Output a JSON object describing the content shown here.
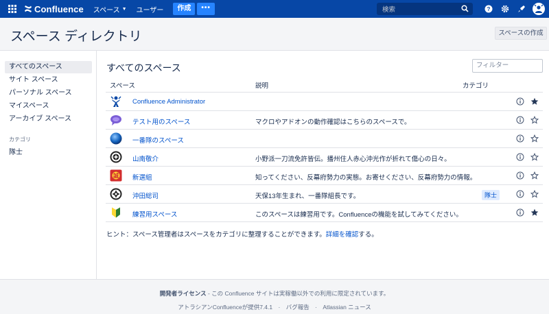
{
  "topnav": {
    "logo_text": "Confluence",
    "spaces_label": "スペース",
    "users_label": "ユーザー",
    "create_label": "作成",
    "more_label": "•••",
    "search_placeholder": "検索"
  },
  "page": {
    "title": "スペース ディレクトリ",
    "create_space_label": "スペースの作成"
  },
  "sidebar": {
    "items": [
      {
        "label": "すべてのスペース",
        "active": true
      },
      {
        "label": "サイト スペース"
      },
      {
        "label": "パーソナル スペース"
      },
      {
        "label": "マイスペース"
      },
      {
        "label": "アーカイブ スペース"
      }
    ],
    "category_heading": "カテゴリ",
    "category_item": "隊士"
  },
  "main": {
    "title": "すべてのスペース",
    "filter_placeholder": "フィルター",
    "columns": {
      "space": "スペース",
      "description": "説明",
      "category": "カテゴリ"
    },
    "rows": [
      {
        "name": "Confluence Administrator",
        "description": "",
        "category": "",
        "icon": "confluence-admin-icon",
        "starred": true
      },
      {
        "name": "テスト用のスペース",
        "description": "マクロやアドオンの動作確認はこちらのスペースで。",
        "category": "",
        "icon": "chat-bubble-icon",
        "starred": false
      },
      {
        "name": "一番隊のスペース",
        "description": "",
        "category": "",
        "icon": "blue-orb-icon",
        "starred": false
      },
      {
        "name": "山南敬介",
        "description": "小野派一刀流免許皆伝。播州住人赤心沖光作が折れて傷心の日々。",
        "category": "",
        "icon": "family-crest-icon",
        "starred": false
      },
      {
        "name": "新選組",
        "description": "知ってください、反幕府勢力の実態。お寄せください、反幕府勢力の情報。",
        "category": "",
        "icon": "red-crest-icon",
        "starred": false
      },
      {
        "name": "沖田総司",
        "description": "天保13年生まれ、一番隊組長です。",
        "category": "隊士",
        "icon": "family-crest-icon",
        "starred": false
      },
      {
        "name": "練習用スペース",
        "description": "このスペースは練習用です。Confluenceの機能を試してみてください。",
        "category": "",
        "icon": "beginner-leaf-icon",
        "starred": true
      }
    ],
    "hint_prefix": "ヒント：スペース管理者はスペースをカテゴリに整理することができます。",
    "hint_link": "詳細を確認",
    "hint_suffix": "する。"
  },
  "footer": {
    "license_bold": "開発者ライセンス",
    "license_text": " - この Confluence サイトは実稼働以外での利用に限定されています。",
    "powered": "アトラシアンConfluenceが提供7.4.1",
    "bug_report": "バグ報告",
    "news": "Atlassian ニュース"
  },
  "colors": {
    "nav_bg": "#0747a6",
    "accent": "#2684ff",
    "link": "#0052cc"
  }
}
